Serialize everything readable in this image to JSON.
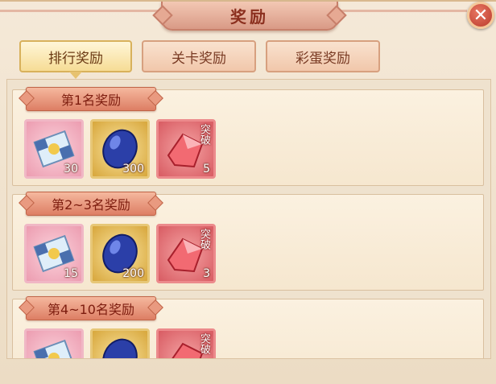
{
  "header": {
    "title": "奖励",
    "close_icon": "close-x-icon"
  },
  "tabs": [
    {
      "label": "排行奖励",
      "active": true
    },
    {
      "label": "关卡奖励",
      "active": false
    },
    {
      "label": "彩蛋奖励",
      "active": false
    }
  ],
  "rank_groups": [
    {
      "title": "第1名奖励",
      "items": [
        {
          "icon": "puzzle-piece-icon",
          "count": "30"
        },
        {
          "icon": "blue-gem-icon",
          "count": "300"
        },
        {
          "icon": "red-crystal-icon",
          "label": "突破",
          "count": "5"
        }
      ]
    },
    {
      "title": "第2~3名奖励",
      "items": [
        {
          "icon": "puzzle-piece-icon",
          "count": "15"
        },
        {
          "icon": "blue-gem-icon",
          "count": "200"
        },
        {
          "icon": "red-crystal-icon",
          "label": "突破",
          "count": "3"
        }
      ]
    },
    {
      "title": "第4~10名奖励",
      "items": [
        {
          "icon": "puzzle-piece-icon",
          "count": ""
        },
        {
          "icon": "blue-gem-icon",
          "count": ""
        },
        {
          "icon": "red-crystal-icon",
          "label": "突破",
          "count": ""
        }
      ]
    }
  ],
  "colors": {
    "accent": "#8b2f1e",
    "banner": "#dd7e64",
    "panel": "#f6e7cf"
  }
}
